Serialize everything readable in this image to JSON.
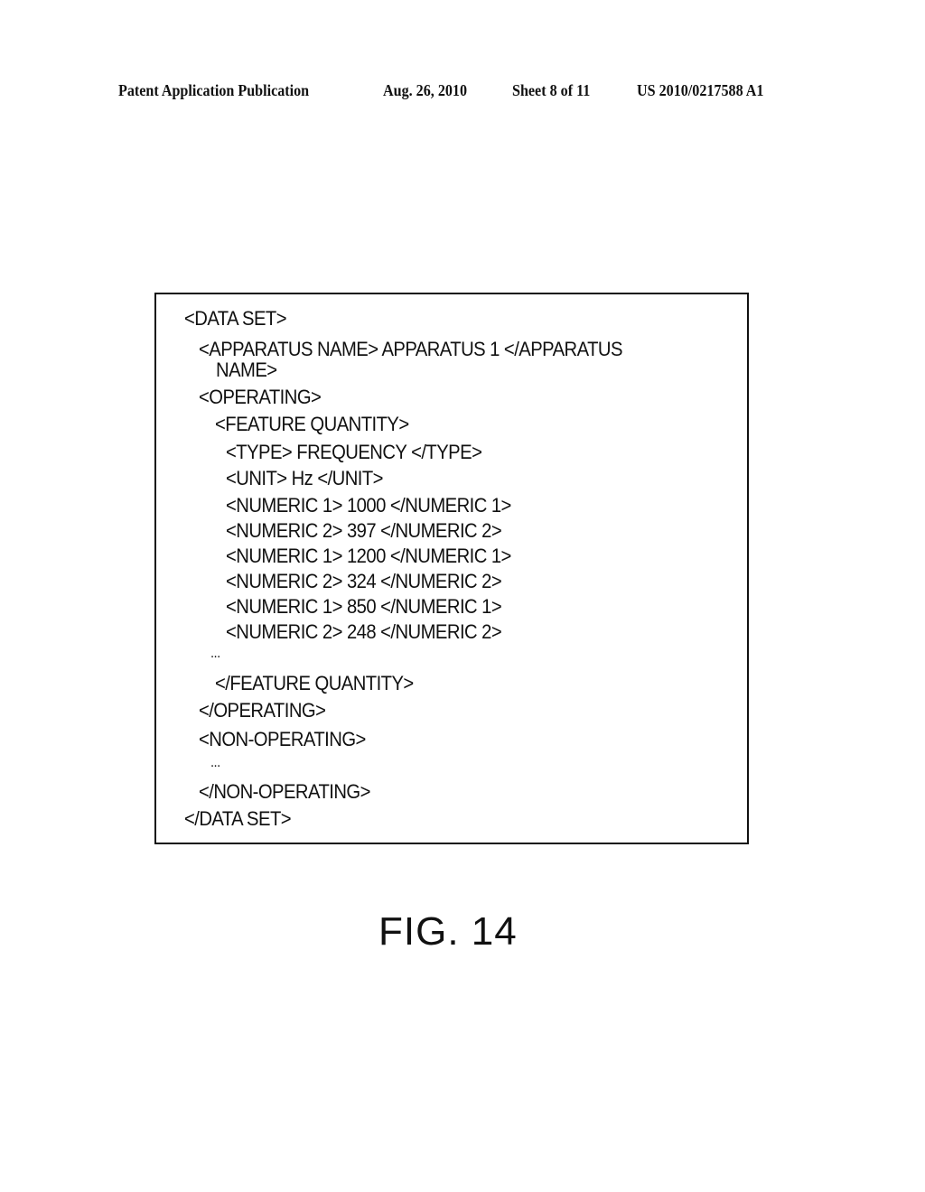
{
  "header": {
    "publication": "Patent Application Publication",
    "date": "Aug. 26, 2010",
    "sheet": "Sheet 8 of 11",
    "number": "US 2010/0217588 A1"
  },
  "figure": {
    "lines": [
      "<DATA SET>",
      "<APPARATUS NAME>  APPARATUS 1  </APPARATUS",
      "NAME>",
      "<OPERATING>",
      "<FEATURE QUANTITY>",
      "<TYPE> FREQUENCY </TYPE>",
      "<UNIT> Hz </UNIT>",
      "<NUMERIC 1> 1000 </NUMERIC 1>",
      "<NUMERIC 2> 397 </NUMERIC 2>",
      "<NUMERIC 1> 1200 </NUMERIC 1>",
      "<NUMERIC 2> 324 </NUMERIC 2>",
      "<NUMERIC 1> 850 </NUMERIC 1>",
      "<NUMERIC 2> 248 </NUMERIC 2>",
      "...",
      "</FEATURE QUANTITY>",
      "</OPERATING>",
      "<NON-OPERATING>",
      "...",
      "</NON-OPERATING>",
      "</DATA SET>"
    ],
    "caption": "FIG. 14"
  }
}
